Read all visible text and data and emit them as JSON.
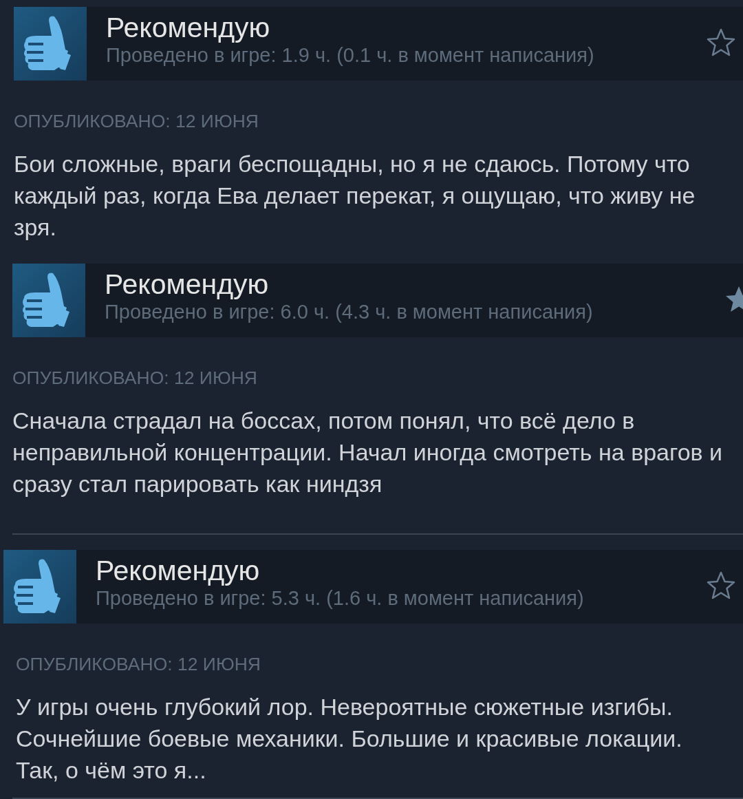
{
  "reviews": [
    {
      "verdict": "Рекомендую",
      "hours": "Проведено в игре: 1.9 ч. (0.1 ч. в момент написания)",
      "starred": false,
      "posted": "ОПУБЛИКОВАНО: 12 ИЮНЯ",
      "text": "Бои сложные, враги беспощадны, но я не сдаюсь. Потому что каждый раз, когда Ева делает перекат, я ощущаю, что живу не зря."
    },
    {
      "verdict": "Рекомендую",
      "hours": "Проведено в игре: 6.0 ч. (4.3 ч. в момент написания)",
      "starred": true,
      "posted": "ОПУБЛИКОВАНО: 12 ИЮНЯ",
      "text": "Сначала страдал на боссах, потом понял, что всё дело в неправильной концентрации. Начал иногда смотреть на врагов и сразу стал парировать как ниндзя"
    },
    {
      "verdict": "Рекомендую",
      "hours": "Проведено в игре: 5.3 ч. (1.6 ч. в момент написания)",
      "starred": false,
      "posted": "ОПУБЛИКОВАНО: 12 ИЮНЯ",
      "text": "У игры очень глубокий лор. Невероятные сюжетные изгибы. Сочнейшие боевые механики. Большие и красивые локации. Так, о чём это я..."
    }
  ]
}
